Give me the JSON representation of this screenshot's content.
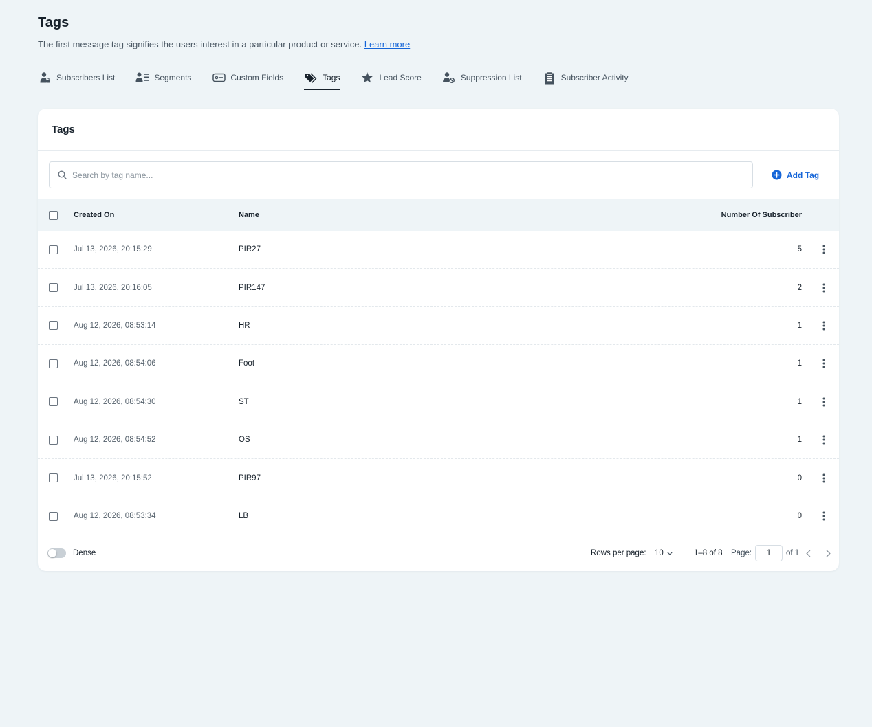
{
  "page": {
    "title": "Tags",
    "description": "The first message tag signifies the users interest in a particular product or service.",
    "learn_more": "Learn more"
  },
  "tabs": [
    {
      "label": "Subscribers List",
      "icon": "user-lock-icon"
    },
    {
      "label": "Segments",
      "icon": "segments-icon"
    },
    {
      "label": "Custom Fields",
      "icon": "custom-fields-icon"
    },
    {
      "label": "Tags",
      "icon": "tags-icon",
      "active": true
    },
    {
      "label": "Lead Score",
      "icon": "star-icon"
    },
    {
      "label": "Suppression List",
      "icon": "user-block-icon"
    },
    {
      "label": "Subscriber Activity",
      "icon": "clipboard-icon"
    }
  ],
  "card": {
    "title": "Tags",
    "search_placeholder": "Search by tag name...",
    "add_button": "Add Tag"
  },
  "table": {
    "columns": {
      "created_on": "Created On",
      "name": "Name",
      "subscribers": "Number Of Subscriber"
    },
    "rows": [
      {
        "created_on": "Jul 13, 2026, 20:15:29",
        "name": "PIR27",
        "subscribers": "5"
      },
      {
        "created_on": "Jul 13, 2026, 20:16:05",
        "name": "PIR147",
        "subscribers": "2"
      },
      {
        "created_on": "Aug 12, 2026, 08:53:14",
        "name": "HR",
        "subscribers": "1"
      },
      {
        "created_on": "Aug 12, 2026, 08:54:06",
        "name": "Foot",
        "subscribers": "1"
      },
      {
        "created_on": "Aug 12, 2026, 08:54:30",
        "name": "ST",
        "subscribers": "1"
      },
      {
        "created_on": "Aug 12, 2026, 08:54:52",
        "name": "OS",
        "subscribers": "1"
      },
      {
        "created_on": "Jul 13, 2026, 20:15:52",
        "name": "PIR97",
        "subscribers": "0"
      },
      {
        "created_on": "Aug 12, 2026, 08:53:34",
        "name": "LB",
        "subscribers": "0"
      }
    ]
  },
  "footer": {
    "dense_label": "Dense",
    "rows_per_page_label": "Rows per page:",
    "rows_per_page_value": "10",
    "range": "1–8 of 8",
    "page_label": "Page:",
    "page_value": "1",
    "of_pages": "of 1"
  },
  "colors": {
    "background": "#eef4f7",
    "accent": "#1565d8",
    "card": "#ffffff"
  }
}
